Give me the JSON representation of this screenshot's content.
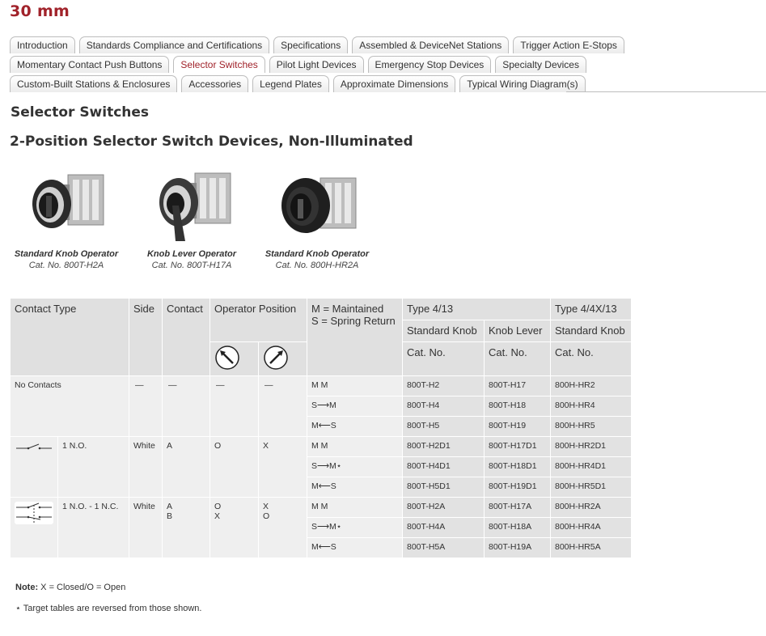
{
  "page": {
    "title": "30 mm"
  },
  "tabs": {
    "row1": [
      "Introduction",
      "Standards Compliance and Certifications",
      "Specifications",
      "Assembled & DeviceNet Stations",
      "Trigger Action E-Stops"
    ],
    "row2": [
      "Momentary Contact Push Buttons",
      "Selector Switches",
      "Pilot Light Devices",
      "Emergency Stop Devices",
      "Specialty Devices"
    ],
    "row3": [
      "Custom-Built Stations & Enclosures",
      "Accessories",
      "Legend Plates",
      "Approximate Dimensions",
      "Typical Wiring Diagram(s)"
    ],
    "active": "Selector Switches"
  },
  "section": {
    "title": "Selector Switches",
    "subtitle": "2-Position Selector Switch Devices, Non-Illuminated"
  },
  "products": [
    {
      "caption": "Standard Knob Operator",
      "catno": "Cat. No. 800T-H2A"
    },
    {
      "caption": "Knob Lever Operator",
      "catno": "Cat. No. 800T-H17A"
    },
    {
      "caption": "Standard Knob Operator",
      "catno": "Cat. No. 800H-HR2A"
    }
  ],
  "table": {
    "headers": {
      "contact_type": "Contact Type",
      "side": "Side",
      "contact": "Contact",
      "operator_position": "Operator Position",
      "legend_line1": "M = Maintained",
      "legend_line2": "S = Spring Return",
      "type_413": "Type 4/13",
      "type_44x13": "Type 4/4X/13",
      "standard_knob": "Standard Knob",
      "knob_lever": "Knob Lever",
      "standard_knob_2": "Standard Knob",
      "cat_no": "Cat. No."
    },
    "groups": [
      {
        "contact_type": "No Contacts",
        "side": "—",
        "contact": "—",
        "pos_left": "—",
        "pos_right": "—",
        "rows": [
          {
            "mode": "M M",
            "std": "800T-H2",
            "lever": "800T-H17",
            "type4x": "800H-HR2"
          },
          {
            "mode": "S⟶M",
            "std": "800T-H4",
            "lever": "800T-H18",
            "type4x": "800H-HR4"
          },
          {
            "mode": "M⟵S",
            "std": "800T-H5",
            "lever": "800T-H19",
            "type4x": "800H-HR5"
          }
        ]
      },
      {
        "contact_type": "1 N.O.",
        "side": "White",
        "contact": "A",
        "pos_left": "O",
        "pos_right": "X",
        "rows": [
          {
            "mode": "M M",
            "std": "800T-H2D1",
            "lever": "800T-H17D1",
            "type4x": "800H-HR2D1"
          },
          {
            "mode": "S⟶M⋆",
            "std": "800T-H4D1",
            "lever": "800T-H18D1",
            "type4x": "800H-HR4D1"
          },
          {
            "mode": "M⟵S",
            "std": "800T-H5D1",
            "lever": "800T-H19D1",
            "type4x": "800H-HR5D1"
          }
        ]
      },
      {
        "contact_type": "1 N.O. - 1 N.C.",
        "side": "White",
        "contact": "A\nB",
        "pos_left": "O\nX",
        "pos_right": "X\nO",
        "rows": [
          {
            "mode": "M M",
            "std": "800T-H2A",
            "lever": "800T-H17A",
            "type4x": "800H-HR2A"
          },
          {
            "mode": "S⟶M⋆",
            "std": "800T-H4A",
            "lever": "800T-H18A",
            "type4x": "800H-HR4A"
          },
          {
            "mode": "M⟵S",
            "std": "800T-H5A",
            "lever": "800T-H19A",
            "type4x": "800H-HR5A"
          }
        ]
      }
    ]
  },
  "notes": {
    "note_label": "Note:",
    "note_text": "X = Closed/O = Open",
    "footnote": "⋆ Target tables are reversed from those shown."
  }
}
